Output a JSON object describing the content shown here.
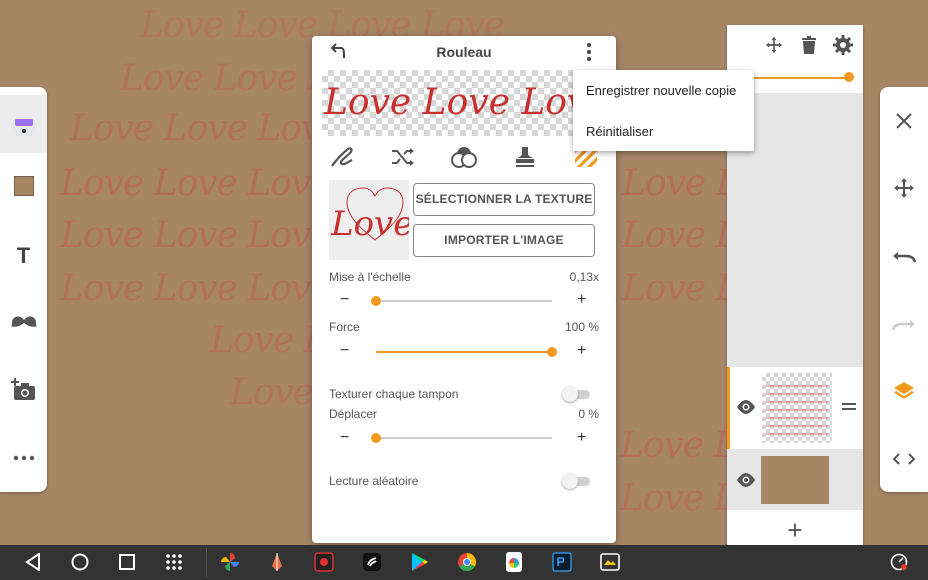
{
  "canvas": {
    "pattern_word": "Love",
    "background_color": "#a78666",
    "ink_color": "#cd3c3c"
  },
  "left_toolbar": {
    "items": [
      {
        "name": "brush-tool",
        "icon": "brush-icon",
        "active": true
      },
      {
        "name": "color-swatch",
        "icon": "color-square",
        "color": "#a78666"
      },
      {
        "name": "text-tool",
        "icon": "T-icon"
      },
      {
        "name": "sticker-tool",
        "icon": "mustache-icon"
      },
      {
        "name": "add-photo",
        "icon": "camera-plus-icon"
      },
      {
        "name": "more",
        "icon": "more-horizontal-icon"
      }
    ]
  },
  "right_toolbar": {
    "items": [
      "close-icon",
      "move-icon",
      "undo-icon",
      "redo-icon",
      "layers-icon",
      "code-icon"
    ]
  },
  "layers_panel": {
    "header_icons": [
      "move-icon",
      "trash-icon",
      "gear-icon"
    ],
    "opacity": 1.0,
    "layers": [
      {
        "name": "texture-layer",
        "visible": true,
        "selected": true
      },
      {
        "name": "background-layer",
        "visible": true,
        "color": "#a78666"
      }
    ],
    "add_label": "+"
  },
  "dialog": {
    "title": "Rouleau",
    "preview_text": "Love Love Love Love",
    "texture_text": "Love",
    "tabs": [
      "stroke-icon",
      "shuffle-icon",
      "blend-icon",
      "stamp-icon",
      "texture-icon"
    ],
    "active_tab": 4,
    "select_texture_label": "SÉLECTIONNER LA TEXTURE",
    "import_image_label": "IMPORTER L'IMAGE",
    "scale": {
      "label": "Mise à l'échelle",
      "value": "0,13x",
      "fraction": 0.0
    },
    "force": {
      "label": "Force",
      "value": "100 %",
      "fraction": 1.0
    },
    "texture_each_stamp": {
      "label": "Texturer chaque tampon",
      "on": false
    },
    "move": {
      "label": "Déplacer",
      "value": "0 %",
      "fraction": 0.0
    },
    "random_play": {
      "label": "Lecture aléatoire",
      "on": false
    },
    "minus": "−",
    "plus": "+"
  },
  "popup_menu": {
    "items": [
      "Enregistrer nouvelle copie",
      "Réinitialiser"
    ]
  },
  "system_bar": {
    "nav": [
      "back-icon",
      "home-icon",
      "recents-icon",
      "apps-grid-icon"
    ],
    "apps": [
      "photos-app",
      "pen-app",
      "screen-recorder-app",
      "notes-app",
      "play-store-app",
      "chrome-app",
      "color-app",
      "photoshop-app",
      "screenshot-app"
    ],
    "status_icon": "speedometer-icon"
  }
}
